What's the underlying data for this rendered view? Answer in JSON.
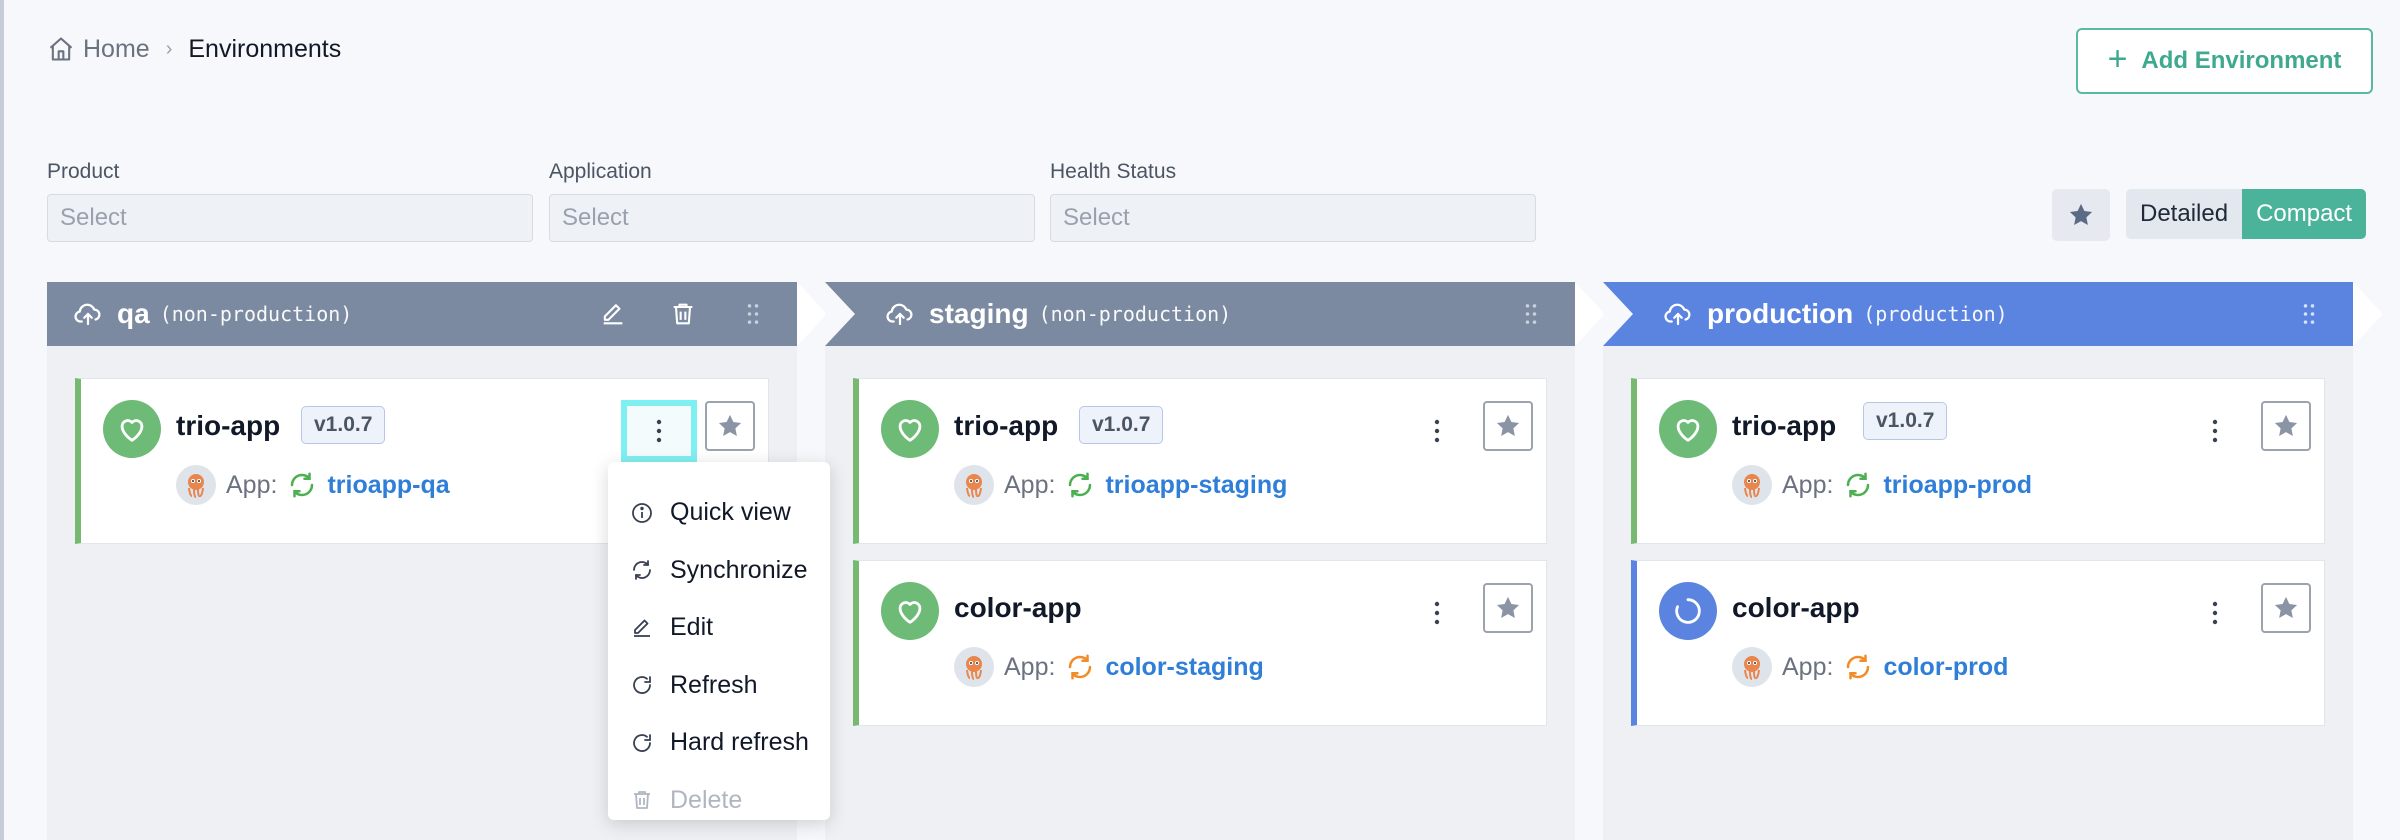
{
  "breadcrumb": {
    "home": "Home",
    "separator": "›",
    "current": "Environments"
  },
  "toolbar": {
    "add_environment": "Add Environment"
  },
  "filters": [
    {
      "label": "Product",
      "placeholder": "Select"
    },
    {
      "label": "Application",
      "placeholder": "Select"
    },
    {
      "label": "Health Status",
      "placeholder": "Select"
    }
  ],
  "view": {
    "detailed": "Detailed",
    "compact": "Compact",
    "active": "Compact"
  },
  "columns": [
    {
      "name": "qa",
      "type": "(non-production)",
      "cards": [
        {
          "title": "trio-app",
          "version": "v1.0.7",
          "app_label": "App:",
          "app_name": "trioapp-qa",
          "health": "healthy",
          "sync": "synced"
        }
      ]
    },
    {
      "name": "staging",
      "type": "(non-production)",
      "cards": [
        {
          "title": "trio-app",
          "version": "v1.0.7",
          "app_label": "App:",
          "app_name": "trioapp-staging",
          "health": "healthy",
          "sync": "synced"
        },
        {
          "title": "color-app",
          "app_label": "App:",
          "app_name": "color-staging",
          "health": "healthy",
          "sync": "out-of-sync"
        }
      ]
    },
    {
      "name": "production",
      "type": "(production)",
      "cards": [
        {
          "title": "trio-app",
          "version": "v1.0.7",
          "app_label": "App:",
          "app_name": "trioapp-prod",
          "health": "healthy",
          "sync": "synced"
        },
        {
          "title": "color-app",
          "app_label": "App:",
          "app_name": "color-prod",
          "health": "progressing",
          "sync": "out-of-sync"
        }
      ]
    }
  ],
  "context_menu": {
    "items": [
      "Quick view",
      "Synchronize",
      "Edit",
      "Refresh",
      "Hard refresh",
      "Delete"
    ]
  },
  "colors": {
    "accent": "#4bb39a",
    "healthy": "#6dbb77",
    "progressing": "#5b84e0",
    "synced": "#4caf50",
    "out_of_sync": "#f28c28",
    "link": "#2f7ed8"
  }
}
